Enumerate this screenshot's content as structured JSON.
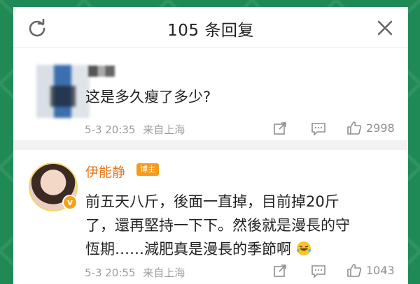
{
  "header": {
    "title": "105 条回复"
  },
  "comments": [
    {
      "text": "这是多久瘦了多少?",
      "time": "5-3 20:35",
      "source": "来自上海",
      "likes": "2998"
    },
    {
      "author": "伊能静",
      "badge": "博主",
      "text_lines": [
        "前五天八斤，後面一直掉，目前掉20斤",
        "了，還再堅持一下下。然後就是漫長的守",
        "恆期……減肥真是漫長的季節啊"
      ],
      "time": "5-3 20:55",
      "source": "来自上海",
      "likes": "1043"
    }
  ],
  "icons": {
    "refresh": "refresh-icon",
    "close": "close-icon",
    "share": "share-icon",
    "comment": "comment-icon",
    "like": "like-icon",
    "emoji": "laugh-cry-emoji-icon",
    "verified": "verified-v-icon"
  },
  "colors": {
    "background": "#1f8a55",
    "author_name": "#e8761a",
    "badge": "#f59a1b",
    "meta_text": "#9a9a9a"
  }
}
